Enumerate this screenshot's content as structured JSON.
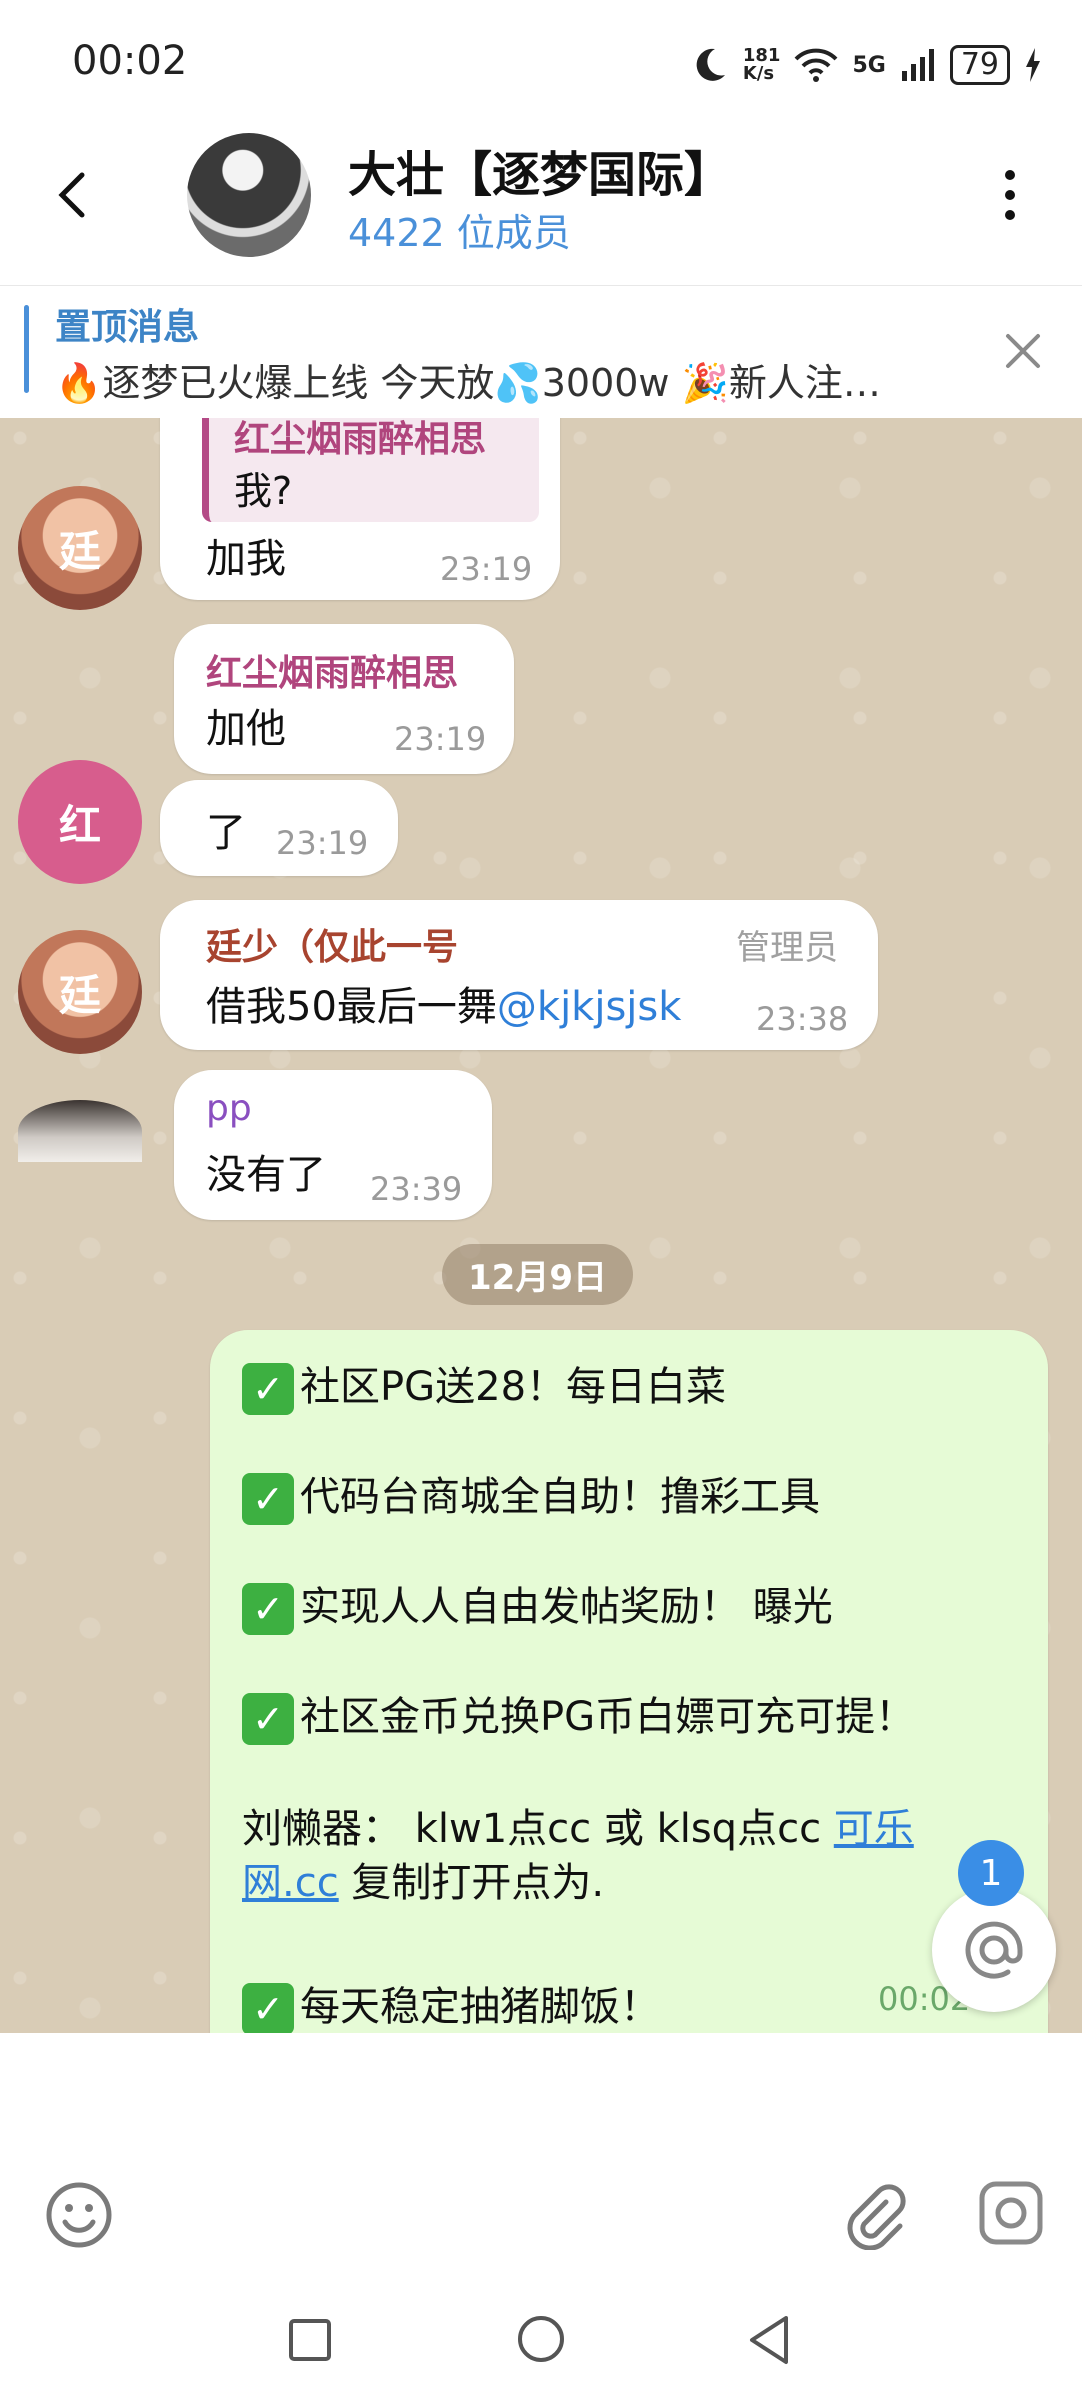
{
  "status_bar": {
    "time": "00:02",
    "net_speed_top": "181",
    "net_speed_bottom": "K/s",
    "network": "5G",
    "battery": "79"
  },
  "header": {
    "title": "大壮【逐梦国际】",
    "members": "4422 位成员"
  },
  "pinned": {
    "title": "置顶消息",
    "text": "🔥逐梦已火爆上线 今天放💦3000w 🎉新人注…"
  },
  "messages": {
    "m1": {
      "quote_sender": "红尘烟雨醉相思",
      "quote_text": "我?",
      "text": "加我",
      "time": "23:19",
      "avatar_text": "廷"
    },
    "m2": {
      "sender": "红尘烟雨醉相思",
      "text": "加他",
      "time": "23:19"
    },
    "m3": {
      "text": "了",
      "time": "23:19",
      "avatar_text": "红"
    },
    "m4": {
      "sender": "廷少（仅此一号",
      "role": "管理员",
      "text": "借我50最后一舞",
      "mention": "@kjkjsjsk",
      "time": "23:38",
      "avatar_text": "廷"
    },
    "m5": {
      "sender": "pp",
      "text": "没有了",
      "time": "23:39"
    }
  },
  "date_separator": "12月9日",
  "outgoing": {
    "lines": [
      "社区PG送28！每日白菜",
      "代码台商城全自助！撸彩工具",
      "实现人人自由发帖奖励！ 曝光",
      "社区金币兑换PG币白嫖可充可提！"
    ],
    "link_prefix": "刘懒器： klw1点cc 或 klsq点cc ",
    "link_part1": "可乐",
    "link_part2": "网.cc",
    "link_suffix": " 复制打开点为.",
    "last_line": "每天稳定抽猪脚饭！",
    "time": "00:02"
  },
  "unread_count": "1",
  "colors": {
    "accent": "#4a90d9",
    "sender_pink": "#b0457d",
    "sender_brown": "#a8442f",
    "sender_purple": "#8a4fc0",
    "chat_bg": "#d9ccb6",
    "outgoing_bubble": "#e6fbd6"
  },
  "icons": [
    "back-arrow-icon",
    "more-vertical-icon",
    "close-icon",
    "emoji-icon",
    "attach-icon",
    "camera-icon",
    "at-icon",
    "square-icon",
    "circle-home-icon",
    "triangle-back-icon"
  ]
}
